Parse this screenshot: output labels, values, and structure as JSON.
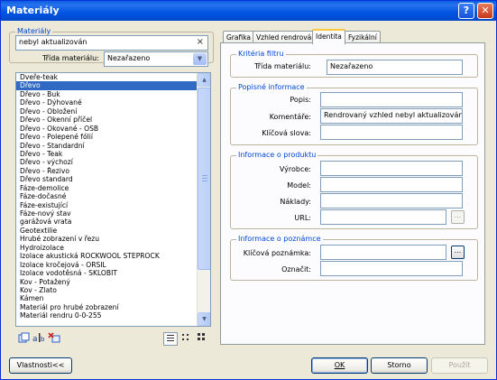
{
  "window": {
    "title": "Materiály",
    "help_glyph": "?",
    "close_glyph": "✕"
  },
  "left": {
    "group_label": "Materiály",
    "search_value": "nebyl aktualizován",
    "search_clear": "×",
    "class_label": "Třída materiálu:",
    "class_value": "Nezařazeno",
    "materials": [
      "Dveře-teak",
      "Dřevo",
      "Dřevo - Buk",
      "Dřevo - Dýhované",
      "Dřevo - Obložení",
      "Dřevo - Okenní příčel",
      "Dřevo - Okované - OSB",
      "Dřevo - Polepené fólií",
      "Dřevo - Standardní",
      "Dřevo - Teak",
      "Dřevo - výchozí",
      "Dřevo - Řezivo",
      "Dřevo standard",
      "Fáze-demolice",
      "Fáze-dočasné",
      "Fáze-existující",
      "Fáze-nový stav",
      "garážová vrata",
      "Geotextilie",
      "Hrubé zobrazení v řezu",
      "Hydroizolace",
      "Izolace akustická ROCKWOOL STEPROCK",
      "Izolace kročejová - ORSIL",
      "Izolace vodotěsná - SKLOBIT",
      "Kov - Potažený",
      "Kov - Zlato",
      "Kámen",
      "Materiál pro hrubé zobrazení",
      "Materiál rendru 0-0-255"
    ],
    "selected_index": 1,
    "toolbar": {
      "new_icon": "new-material-icon",
      "rename_icon": "rename-material-icon",
      "delete_icon": "delete-material-icon",
      "list_view_icon": "list-view-icon",
      "small_icons_icon": "small-icons-view-icon",
      "large_icons_icon": "large-icons-view-icon"
    }
  },
  "tabs": [
    {
      "label": "Grafika"
    },
    {
      "label": "Vzhled rendrování"
    },
    {
      "label": "Identita"
    },
    {
      "label": "Fyzikální"
    }
  ],
  "identity": {
    "filter_group": "Kritéria filtru",
    "class_label": "Třída materiálu:",
    "class_value": "Nezařazeno",
    "desc_group": "Popisné informace",
    "description_label": "Popis:",
    "description_value": "",
    "comments_label": "Komentáře:",
    "comments_value": "Rendrovaný vzhled nebyl aktualizován.",
    "keywords_label": "Klíčová slova:",
    "keywords_value": "",
    "product_group": "Informace o produktu",
    "manufacturer_label": "Výrobce:",
    "manufacturer_value": "",
    "model_label": "Model:",
    "model_value": "",
    "cost_label": "Náklady:",
    "cost_value": "",
    "url_label": "URL:",
    "url_value": "",
    "browse": "...",
    "notes_group": "Informace o poznámce",
    "keynote_label": "Klíčová poznámka:",
    "keynote_value": "",
    "mark_label": "Označit:",
    "mark_value": ""
  },
  "buttons": {
    "properties": "Vlastnosti<<",
    "ok": "OK",
    "cancel": "Storno",
    "apply": "Použít"
  }
}
